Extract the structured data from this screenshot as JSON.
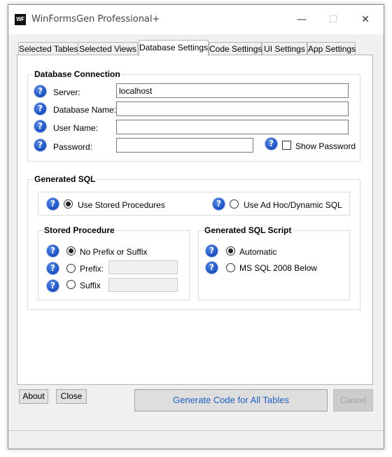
{
  "window": {
    "title": "WinFormsGen Professional+",
    "icon_text": "WF",
    "minimize": "—",
    "maximize": "☐",
    "close": "✕"
  },
  "tabs": [
    "Selected Tables",
    "Selected Views",
    "Database Settings",
    "Code Settings",
    "UI Settings",
    "App Settings"
  ],
  "active_tab": "Database Settings",
  "db_connection": {
    "title": "Database Connection",
    "server_label": "Server:",
    "server_value": "localhost",
    "database_label": "Database Name:",
    "database_value": "",
    "user_label": "User Name:",
    "user_value": "",
    "password_label": "Password:",
    "password_value": "",
    "show_password_label": "Show Password",
    "show_password_checked": false
  },
  "generated_sql": {
    "title": "Generated SQL",
    "stored_procedures_label": "Use Stored Procedures",
    "adhoc_label": "Use Ad Hoc/Dynamic SQL",
    "selected": "stored_procedures"
  },
  "stored_procedure": {
    "title": "Stored Procedure",
    "no_prefix_label": "No Prefix or Suffix",
    "prefix_label": "Prefix:",
    "prefix_value": "",
    "suffix_label": "Suffix",
    "suffix_value": "",
    "selected": "none"
  },
  "sql_script": {
    "title": "Generated SQL Script",
    "automatic_label": "Automatic",
    "mssql2008_label": "MS SQL 2008  Below",
    "selected": "automatic"
  },
  "help_icon": "?",
  "buttons": {
    "about": "About",
    "close": "Close",
    "generate": "Generate Code for All Tables",
    "cancel": "Cancel"
  },
  "colors": {
    "accent_text": "#1e5fc3",
    "help_icon": "#1f55c5"
  }
}
